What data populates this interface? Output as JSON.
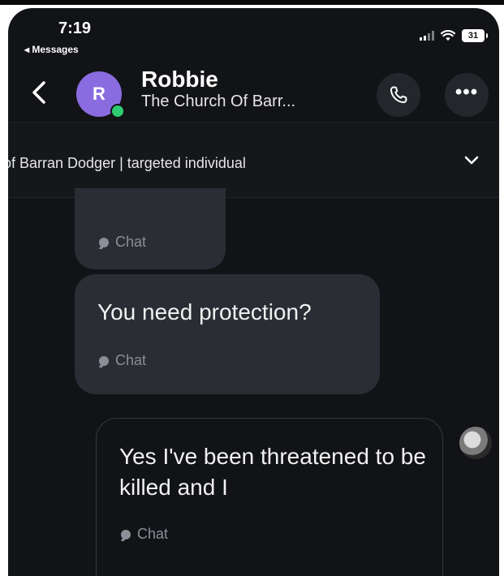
{
  "status_bar": {
    "time": "7:19",
    "back_app": "◂ Messages",
    "battery": "31"
  },
  "header": {
    "avatar_initial": "R",
    "name": "Robbie",
    "subtitle": "The Church Of Barr..."
  },
  "topic": {
    "text": "of Barran Dodger | targeted individual"
  },
  "messages": [
    {
      "text": "",
      "tag": "Chat"
    },
    {
      "text": "You need protection?",
      "tag": "Chat"
    },
    {
      "text": "Yes I've been threatened to be killed and I",
      "tag": "Chat"
    }
  ]
}
